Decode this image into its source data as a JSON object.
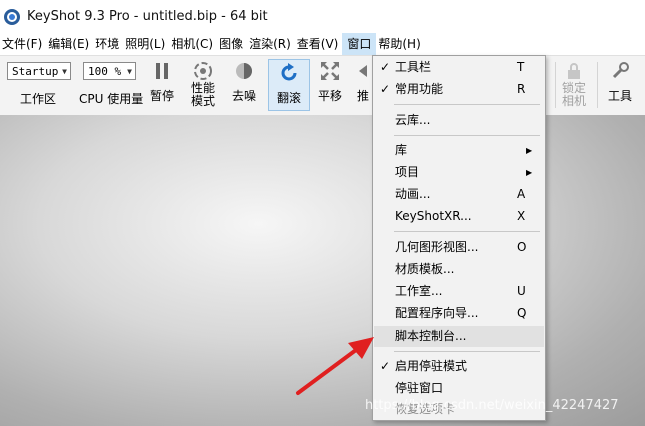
{
  "window": {
    "title": "KeyShot 9.3 Pro  - untitled.bip  - 64 bit"
  },
  "menubar": {
    "items": [
      "文件(F)",
      "编辑(E)",
      "环境",
      "照明(L)",
      "相机(C)",
      "图像",
      "渲染(R)",
      "查看(V)",
      "窗口",
      "帮助(H)"
    ]
  },
  "toolbar": {
    "workspace_combo": "Startup",
    "workspace_label": "工作区",
    "cpu_combo": "100 %",
    "cpu_label": "CPU 使用量",
    "pause_label": "暂停",
    "perf_label_1": "性能",
    "perf_label_2": "模式",
    "denoise_label": "去噪",
    "tumble_label": "翻滚",
    "pan_label": "平移",
    "push_label": "推",
    "lock_label_1": "锁定",
    "lock_label_2": "相机",
    "tools_label": "工具"
  },
  "window_menu": {
    "items": [
      {
        "label": "工具栏",
        "shortcut": "T",
        "checked": true
      },
      {
        "label": "常用功能",
        "shortcut": "R",
        "checked": true
      },
      {
        "label": "云库..."
      },
      {
        "label": "库",
        "submenu": true
      },
      {
        "label": "项目",
        "submenu": true
      },
      {
        "label": "动画...",
        "shortcut": "A"
      },
      {
        "label": "KeyShotXR...",
        "shortcut": "X"
      },
      {
        "label": "几何图形视图...",
        "shortcut": "O"
      },
      {
        "label": "材质模板..."
      },
      {
        "label": "工作室...",
        "shortcut": "U"
      },
      {
        "label": "配置程序向导...",
        "shortcut": "Q"
      },
      {
        "label": "脚本控制台..."
      },
      {
        "label": "启用停驻模式",
        "checked": true
      },
      {
        "label": "停驻窗口"
      },
      {
        "label": "恢复选项卡"
      }
    ]
  },
  "watermark": "https://blog.csdn.net/weixin_42247427",
  "colors": {
    "menu_open": "#cce4f7",
    "annotation_arrow": "#e02020"
  }
}
